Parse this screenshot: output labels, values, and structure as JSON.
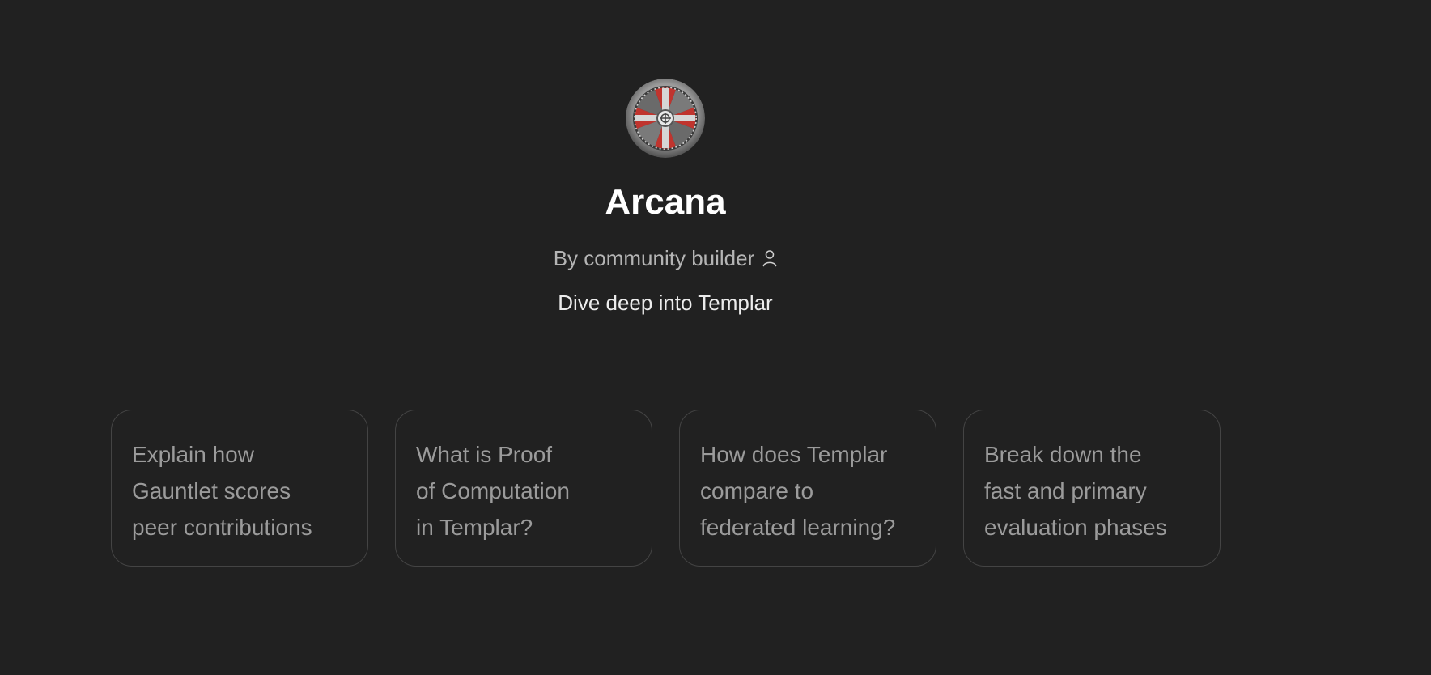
{
  "gpt": {
    "name": "Arcana",
    "byline": "By community builder",
    "description": "Dive deep into Templar",
    "avatar_colors": {
      "metal": "#9a9a9a",
      "red": "#c0342e",
      "dark": "#3a3a3a"
    }
  },
  "icons": {
    "creator": "person-icon",
    "avatar": "templar-emblem-icon"
  },
  "starters": [
    {
      "text": "Explain how\nGauntlet scores\npeer contributions"
    },
    {
      "text": "What is Proof\nof Computation\nin Templar?"
    },
    {
      "text": "How does Templar\ncompare to\nfederated learning?"
    },
    {
      "text": "Break down the\nfast and primary\nevaluation phases"
    }
  ]
}
